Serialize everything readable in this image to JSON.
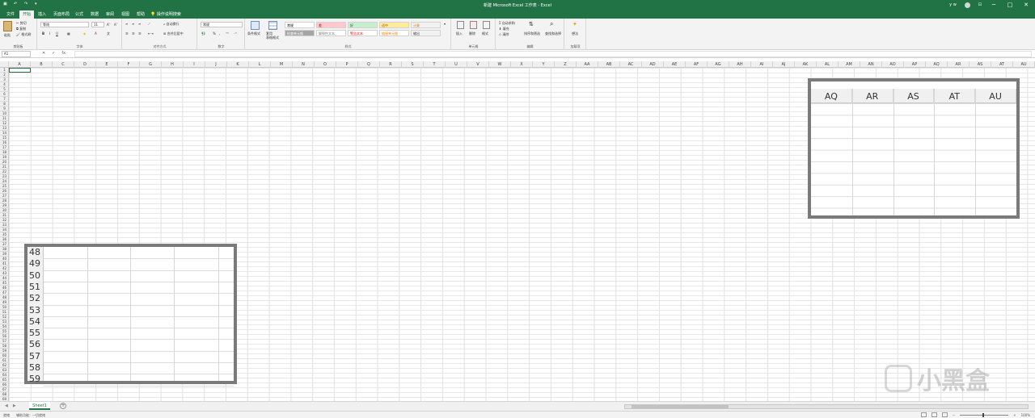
{
  "window": {
    "title": "新建 Microsoft Excel 工作表 - Excel",
    "user": "y w",
    "controls": [
      "─",
      "□",
      "✕"
    ]
  },
  "tabs": [
    {
      "label": "文件"
    },
    {
      "label": "开始",
      "active": true
    },
    {
      "label": "插入"
    },
    {
      "label": "页面布局"
    },
    {
      "label": "公式"
    },
    {
      "label": "数据"
    },
    {
      "label": "审阅"
    },
    {
      "label": "视图"
    },
    {
      "label": "帮助"
    }
  ],
  "tell_me": "操作说明搜索",
  "ribbon": {
    "clipboard": {
      "label": "剪贴板",
      "paste": "粘贴",
      "cut": "剪切",
      "copy": "复制",
      "format_painter": "格式刷"
    },
    "font": {
      "label": "字体",
      "font_name": "等线",
      "font_size": "11",
      "bold": "B",
      "italic": "I",
      "underline": "U"
    },
    "alignment": {
      "label": "对齐方式",
      "wrap": "自动换行",
      "merge": "合并后居中"
    },
    "number": {
      "label": "数字",
      "format": "常规"
    },
    "styles": {
      "label": "样式",
      "conditional": "条件格式",
      "table_format": "套用\n表格格式",
      "cells": [
        {
          "label": "常规",
          "bg": "#ffffff",
          "fg": "#000000"
        },
        {
          "label": "差",
          "bg": "#ffc7ce",
          "fg": "#9c0006"
        },
        {
          "label": "好",
          "bg": "#c6efce",
          "fg": "#006100"
        },
        {
          "label": "适中",
          "bg": "#ffeb9c",
          "fg": "#9c5700"
        },
        {
          "label": "计算",
          "bg": "#f2f2f2",
          "fg": "#fa7d00"
        },
        {
          "label": "检查单元格",
          "bg": "#a5a5a5",
          "fg": "#ffffff"
        },
        {
          "label": "解释性文本",
          "bg": "#ffffff",
          "fg": "#7f7f7f"
        },
        {
          "label": "警告文本",
          "bg": "#ffffff",
          "fg": "#ff0000"
        },
        {
          "label": "链接单元格",
          "bg": "#ffffff",
          "fg": "#fa7d00"
        },
        {
          "label": "输出",
          "bg": "#f2f2f2",
          "fg": "#3f3f3f"
        }
      ]
    },
    "cells_group": {
      "label": "单元格",
      "insert": "插入",
      "delete": "删除",
      "format": "格式"
    },
    "editing": {
      "label": "编辑",
      "autosum": "自动求和",
      "fill": "填充",
      "clear": "清除",
      "sort": "排序和筛选",
      "find": "查找和选择"
    },
    "ideas": {
      "label": "加载项",
      "btn": "想法"
    }
  },
  "formula_bar": {
    "name_box": "A1",
    "cancel": "✕",
    "enter": "✓",
    "fx": "fx",
    "value": ""
  },
  "columns": [
    "A",
    "B",
    "C",
    "D",
    "E",
    "F",
    "G",
    "H",
    "I",
    "J",
    "K",
    "L",
    "M",
    "N",
    "O",
    "P",
    "Q",
    "R",
    "S",
    "T",
    "U",
    "V",
    "W",
    "X",
    "Y",
    "Z",
    "AA",
    "AB",
    "AC",
    "AD",
    "AE",
    "AF",
    "AG",
    "AH",
    "AI",
    "AJ",
    "AK",
    "AL",
    "AM",
    "AN",
    "AO",
    "AP",
    "AQ",
    "AR",
    "AS",
    "AT",
    "AU"
  ],
  "rows": [
    "1",
    "2",
    "3",
    "4",
    "5",
    "6",
    "7",
    "8",
    "9",
    "10",
    "11",
    "12",
    "13",
    "14",
    "15",
    "16",
    "17",
    "18",
    "19",
    "20",
    "21",
    "22",
    "23",
    "24",
    "25",
    "26",
    "27",
    "28",
    "29",
    "30",
    "31",
    "32",
    "33",
    "34",
    "35",
    "36",
    "37",
    "38",
    "39",
    "40",
    "41",
    "42",
    "43",
    "44",
    "45",
    "46",
    "47",
    "48",
    "49",
    "50",
    "51",
    "52",
    "53",
    "54",
    "55",
    "56",
    "57",
    "58",
    "59",
    "60",
    "61",
    "62",
    "63",
    "64",
    "65",
    "66",
    "67",
    "68",
    "69",
    "70"
  ],
  "zoom_top": {
    "columns": [
      "AQ",
      "AR",
      "AS",
      "AT",
      "AU"
    ]
  },
  "zoom_bottom": {
    "rows": [
      "48",
      "49",
      "50",
      "51",
      "52",
      "53",
      "54",
      "55",
      "56",
      "57",
      "58",
      "59"
    ]
  },
  "sheets": [
    {
      "name": "Sheet1",
      "active": true
    }
  ],
  "status": {
    "ready": "就绪",
    "accessibility": "辅助功能：一切就绪",
    "zoom": "100%"
  },
  "watermark": "小黑盒"
}
